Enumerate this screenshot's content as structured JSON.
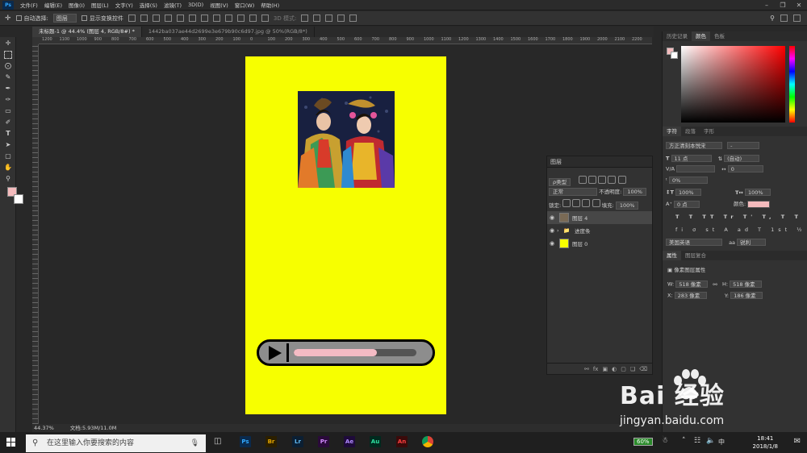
{
  "app": {
    "logo": "Ps"
  },
  "menu": [
    "文件(F)",
    "编辑(E)",
    "图像(I)",
    "图层(L)",
    "文字(Y)",
    "选择(S)",
    "滤镜(T)",
    "3D(D)",
    "视图(V)",
    "窗口(W)",
    "帮助(H)"
  ],
  "options": {
    "auto_select": "自动选择:",
    "auto_select_value": "图层",
    "show_transform": "显示变换控件",
    "mode_3d": "3D 模式:"
  },
  "tabs": [
    "未标题-1 @ 44.4% (图层 4, RGB/8#) *",
    "1442ba037ae44d2699e3e679b90c6d97.jpg @ 50%(RGB/8*)"
  ],
  "ruler": [
    "1200",
    "1100",
    "1000",
    "900",
    "800",
    "700",
    "600",
    "500",
    "400",
    "300",
    "200",
    "100",
    "0",
    "100",
    "200",
    "300",
    "400",
    "500",
    "600",
    "700",
    "800",
    "900",
    "1000",
    "1100",
    "1200",
    "1300",
    "1400",
    "1500",
    "1600",
    "1700",
    "1800",
    "1900",
    "2000",
    "2100",
    "2200"
  ],
  "status": {
    "zoom": "44.37%",
    "doc": "文档:5.93M/11.0M"
  },
  "player": {
    "progress": 0.68
  },
  "colors": {
    "fg": "#f4bbbd",
    "bg": "#ffffff",
    "artboard": "#f7ff00",
    "progress_fill": "#f4bbc4"
  },
  "layers_panel": {
    "title": "图层",
    "filter": "ρ类型",
    "blend_mode": "正常",
    "opacity_label": "不透明度:",
    "opacity": "100%",
    "lock_label": "锁定:",
    "fill_label": "填充:",
    "fill": "100%",
    "items": [
      {
        "name": "图层 4",
        "thumb": "#7a6a55"
      },
      {
        "name": "进度条",
        "thumb": ""
      },
      {
        "name": "图层 0",
        "thumb": "#f7ff00"
      }
    ]
  },
  "color_panel": {
    "tabs": [
      "历史记录",
      "颜色",
      "色板"
    ]
  },
  "char_panel": {
    "tabs": [
      "字符",
      "段落",
      "字形"
    ],
    "font": "方正清刻本悦宋",
    "style": "-",
    "size": "11 点",
    "leading": "(自动)",
    "kerning_label": "V/A",
    "kerning": "",
    "tracking": "0",
    "scale_label": "ᵗ",
    "scale": "0%",
    "vscale": "100%",
    "hscale": "100%",
    "baseline": "0 点",
    "color_label": "颜色:",
    "language": "美国英语",
    "aa_label": "aa",
    "aa": "锐利"
  },
  "props_panel": {
    "tabs": [
      "属性",
      "图层复合"
    ],
    "heading": "像素图层属性",
    "w_label": "W:",
    "w": "518 像素",
    "h_label": "H:",
    "h": "518 像素",
    "x_label": "X:",
    "x": "283 像素",
    "y_label": "Y:",
    "y": "186 像素"
  },
  "taskbar": {
    "search_placeholder": "在这里输入你要搜索的内容",
    "apps": [
      "Ps",
      "Br",
      "Lr",
      "Pr",
      "Ae",
      "Au",
      "An"
    ],
    "battery": "60%",
    "ime": "中",
    "time": "18:41",
    "date": "2018/1/8"
  },
  "watermark": {
    "brand": "Bai 经验",
    "url": "jingyan.baidu.com"
  }
}
